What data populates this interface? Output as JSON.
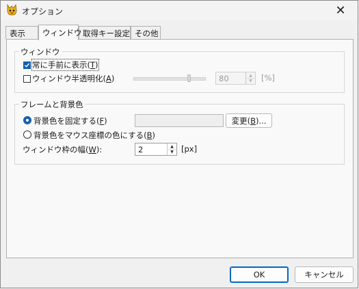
{
  "window": {
    "title": "オプション"
  },
  "tabs": [
    {
      "label": "表示"
    },
    {
      "label": "ウィンドウ"
    },
    {
      "label": "取得キー設定"
    },
    {
      "label": "その他"
    }
  ],
  "window_group": {
    "title": "ウィンドウ",
    "always_on_top": {
      "label": "常に手前に表示(",
      "key": "T",
      "end": ")",
      "checked": true
    },
    "translucent": {
      "label": "ウィンドウ半透明化(",
      "key": "A",
      "end": ")",
      "checked": false
    },
    "opacity_value": "80",
    "opacity_unit": "[%]"
  },
  "frame_group": {
    "title": "フレームと背景色",
    "fixed_bg": {
      "label": "背景色を固定する(",
      "key": "F",
      "end": ")",
      "selected": true
    },
    "change_button": {
      "label": "変更(",
      "key": "B",
      "end": ")..."
    },
    "mouse_color": {
      "label": "背景色をマウス座標の色にする(",
      "key": "B",
      "end": ")",
      "selected": false
    },
    "frame_width": {
      "label": "ウィンドウ枠の幅(",
      "key": "W",
      "end": "):",
      "value": "2",
      "unit": "[px]"
    }
  },
  "footer": {
    "ok": "OK",
    "cancel": "キャンセル"
  },
  "colors": {
    "accent": "#1560b0",
    "ok_border": "#0067c0"
  }
}
